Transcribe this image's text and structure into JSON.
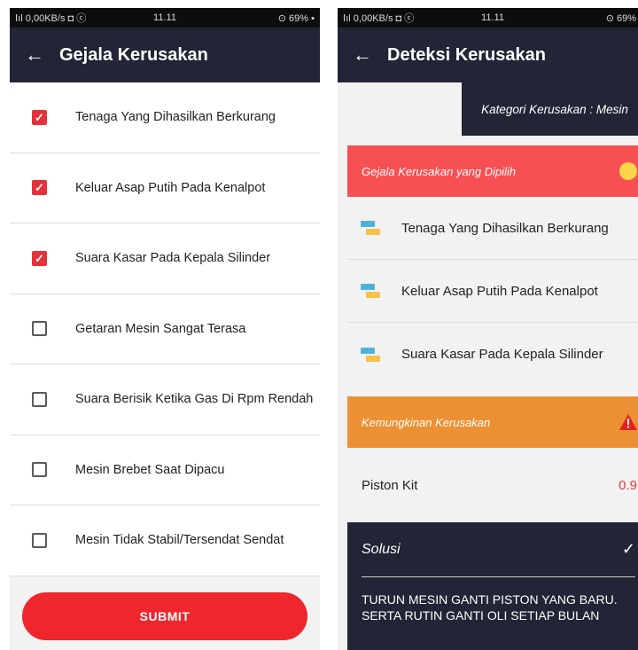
{
  "left_screen": {
    "status_bar": {
      "network": "ⵏıl 0,00KB/s ◘ ⓒ",
      "time": "11.11",
      "battery": "⊙ 69% ▪"
    },
    "title": "Gejala Kerusakan",
    "symptoms": [
      {
        "label": "Tenaga Yang Dihasilkan Berkurang",
        "checked": true
      },
      {
        "label": "Keluar Asap Putih Pada Kenalpot",
        "checked": true
      },
      {
        "label": "Suara Kasar Pada Kepala Silinder",
        "checked": true
      },
      {
        "label": "Getaran Mesin Sangat Terasa",
        "checked": false
      },
      {
        "label": "Suara Berisik Ketika Gas Di Rpm Rendah",
        "checked": false
      },
      {
        "label": "Mesin Brebet Saat Dipacu",
        "checked": false
      },
      {
        "label": "Mesin Tidak Stabil/Tersendat Sendat",
        "checked": false
      }
    ],
    "submit_label": "SUBMIT"
  },
  "right_screen": {
    "status_bar": {
      "network": "ⵏıl 0,00KB/s ◘ ⓒ",
      "time": "11.11",
      "battery": "⊙ 69% ▪"
    },
    "title": "Deteksi Kerusakan",
    "category": "Kategori Kerusakan : Mesin",
    "selected_header": "Gejala Kerusakan yang Dipilih",
    "selected_symptoms": [
      "Tenaga Yang Dihasilkan Berkurang",
      "Keluar Asap Putih Pada Kenalpot",
      "Suara Kasar Pada Kepala Silinder"
    ],
    "possible_header": "Kemungkinan Kerusakan",
    "result": {
      "name": "Piston Kit",
      "value": "0.9"
    },
    "solution": {
      "title": "Solusi",
      "line1": "TURUN MESIN GANTI PISTON YANG BARU.",
      "line2": "SERTA RUTIN GANTI OLI SETIAP BULAN"
    }
  },
  "colors": {
    "appbar": "#222535",
    "accent_red": "#f0262d",
    "checkbox_red": "#e5313a",
    "selected_header": "#f75053",
    "possible_header": "#eb9134",
    "info_yellow": "#ffd54a"
  },
  "icons": [
    "back-arrow-icon",
    "checkbox-icon",
    "info-icon",
    "warning-icon",
    "swap-icon",
    "checkmark-icon"
  ]
}
